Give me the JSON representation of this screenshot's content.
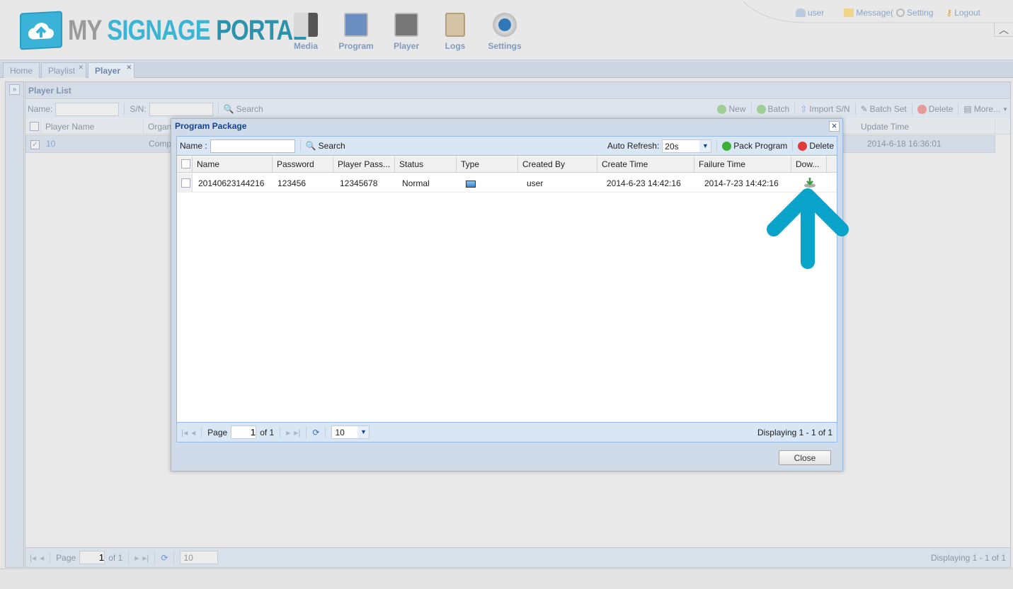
{
  "brand": {
    "my": "MY",
    "signage": "SIGNAGE",
    "portal": "PORTAL"
  },
  "nav": [
    {
      "label": "Media",
      "icon": "media-icon"
    },
    {
      "label": "Program",
      "icon": "program-icon"
    },
    {
      "label": "Player",
      "icon": "player-icon"
    },
    {
      "label": "Logs",
      "icon": "logs-icon"
    },
    {
      "label": "Settings",
      "icon": "settings-icon"
    }
  ],
  "toplinks": {
    "user": "user",
    "message": "Message(",
    "setting": "Setting",
    "logout": "Logout"
  },
  "tabs": [
    {
      "label": "Home"
    },
    {
      "label": "Playlist"
    },
    {
      "label": "Player"
    }
  ],
  "player_list": {
    "title": "Player List",
    "name_label": "Name:",
    "sn_label": "S/N:",
    "search": "Search",
    "actions": {
      "new": "New",
      "batch": "Batch",
      "import": "Import S/N",
      "batch_set": "Batch Set",
      "delete": "Delete",
      "more": "More..."
    },
    "columns": [
      "Player Name",
      "Organ",
      "Update Time"
    ],
    "rows": [
      {
        "player_name": "10",
        "organ": "Comp",
        "update_time": "2014-6-18 16:36:01",
        "checked": true
      }
    ],
    "pager": {
      "page_label": "Page",
      "page": "1",
      "of": "of 1",
      "page_size": "10",
      "display": "Displaying 1 - 1 of 1"
    }
  },
  "modal": {
    "title": "Program Package",
    "name_label": "Name :",
    "name_value": "",
    "search": "Search",
    "auto_refresh_label": "Auto Refresh:",
    "auto_refresh_value": "20s",
    "pack": "Pack Program",
    "delete": "Delete",
    "columns": [
      "Name",
      "Password",
      "Player Pass...",
      "Status",
      "Type",
      "Created By",
      "Create Time",
      "Failure Time",
      "Dow..."
    ],
    "rows": [
      {
        "name": "20140623144216",
        "password": "123456",
        "player_password": "12345678",
        "status": "Normal",
        "type": "screen-icon",
        "created_by": "user",
        "create_time": "2014-6-23 14:42:16",
        "failure_time": "2014-7-23 14:42:16",
        "download": "download-icon"
      }
    ],
    "pager": {
      "page_label": "Page",
      "page": "1",
      "of": "of 1",
      "page_size": "10",
      "display": "Displaying 1 - 1 of 1"
    },
    "close": "Close"
  },
  "colors": {
    "accent": "#15428b",
    "arrow": "#0aa3c9",
    "brand_cyan": "#3ab5d6"
  }
}
